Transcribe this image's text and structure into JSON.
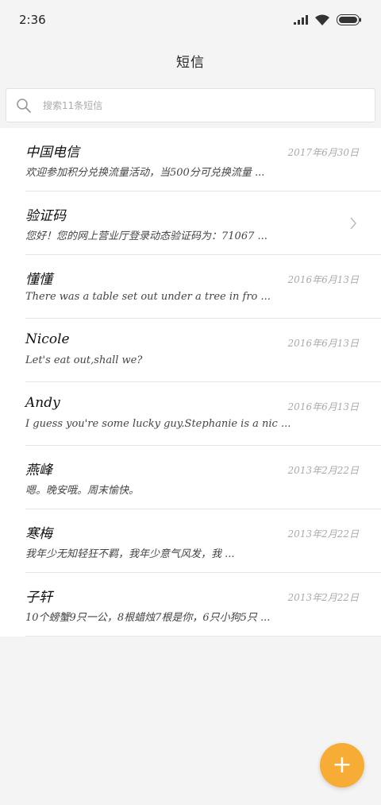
{
  "status_bar": {
    "time": "2:36",
    "icons": [
      "signal-icon",
      "wifi-icon",
      "battery-icon"
    ]
  },
  "header": {
    "title": "短信"
  },
  "search": {
    "placeholder": "搜索11条短信"
  },
  "conversations": [
    {
      "name": "中国电信",
      "date": "2017年6月30日",
      "preview": "欢迎参加积分兑换流量活动，当500分可兑换流量 ...",
      "has_chevron": false
    },
    {
      "name": "验证码",
      "date": "",
      "preview": "您好！您的网上营业厅登录动态验证码为：71067 ...",
      "has_chevron": true
    },
    {
      "name": "懂懂",
      "date": "2016年6月13日",
      "preview": "There was a table set out under a tree in fro ...",
      "has_chevron": false
    },
    {
      "name": "Nicole",
      "date": "2016年6月13日",
      "preview": "Let's eat out,shall we?",
      "has_chevron": false
    },
    {
      "name": "Andy",
      "date": "2016年6月13日",
      "preview": "I guess you're some lucky guy.Stephanie is a nic ...",
      "has_chevron": false
    },
    {
      "name": "燕峰",
      "date": "2013年2月22日",
      "preview": "嗯。晚安哦。周末愉快。",
      "has_chevron": false
    },
    {
      "name": "寒梅",
      "date": "2013年2月22日",
      "preview": "我年少无知轻狂不羁，我年少意气风发，我 ...",
      "has_chevron": false
    },
    {
      "name": "子轩",
      "date": "2013年2月22日",
      "preview": "10个螃蟹9只一公，8根蜡烛7根是你，6只小狗5只 ...",
      "has_chevron": false
    }
  ],
  "fab": {
    "label": "+"
  },
  "colors": {
    "accent": "#f7ac36",
    "background": "#f4f4f4",
    "list_bg": "#ffffff",
    "divider": "#e6e6e6"
  }
}
